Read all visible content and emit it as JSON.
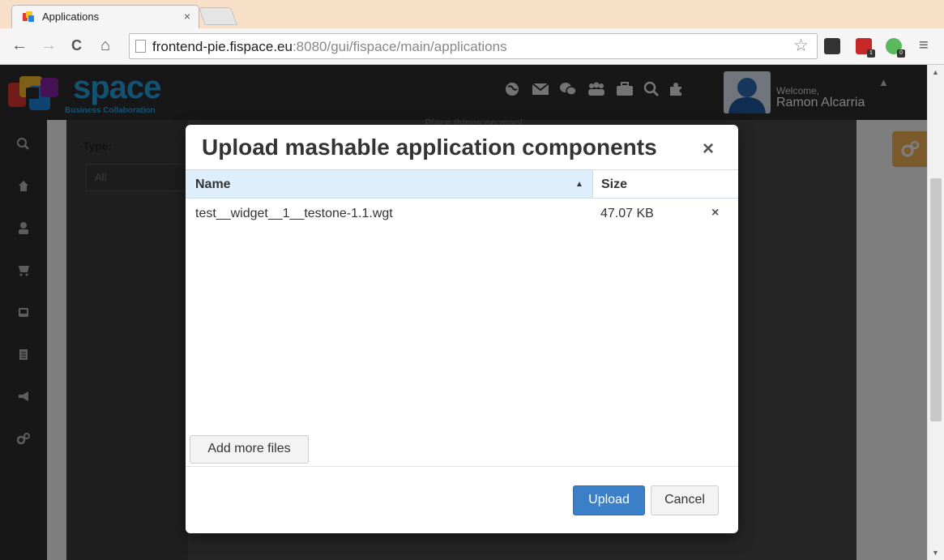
{
  "browser": {
    "tab_title": "Applications",
    "tab_close": "×",
    "url_host": "frontend-pie.fispace.eu",
    "url_rest": ":8080/gui/fispace/main/applications",
    "back": "←",
    "forward": "→",
    "reload": "C",
    "home": "⌂",
    "bookmark_star": "☆",
    "menu": "≡",
    "ext_badge_1": "1",
    "ext_badge_2": "0"
  },
  "app": {
    "logo_text": "space",
    "logo_subtitle": "Business Collaboration",
    "welcome": "Welcome,",
    "username": "Ramon Alcarria",
    "header_caret": "▲",
    "sidebar_icons": [
      "search-icon",
      "home-icon",
      "user-icon",
      "cart-icon",
      "inbox-icon",
      "document-icon",
      "megaphone-icon",
      "cogs-icon"
    ],
    "header_icons": [
      "globe-icon",
      "mail-icon",
      "chat-icon",
      "group-icon",
      "briefcase-icon",
      "search-icon",
      "puzzle-icon"
    ],
    "filter_label": "Type:",
    "filter_value": "All",
    "peek_text": "Place things on map!"
  },
  "modal": {
    "title": "Upload mashable application components",
    "close": "×",
    "columns": {
      "name": "Name",
      "size": "Size",
      "sort": "▲"
    },
    "files": [
      {
        "name": "test__widget__1__testone-1.1.wgt",
        "size": "47.07 KB",
        "remove": "×"
      }
    ],
    "add_more_label": "Add more files",
    "upload_label": "Upload",
    "cancel_label": "Cancel"
  },
  "colors": {
    "upload_button": "#3a7fc7",
    "grid_header": "#dfeefb",
    "logo_blue": "#2aa4e4",
    "settings_tab": "#f6b656"
  }
}
